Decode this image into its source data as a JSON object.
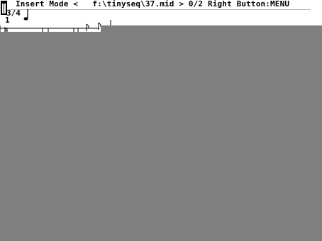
{
  "status_bar": {
    "mode_label": "Insert Mode",
    "file_prefix": "<",
    "file_path": "f:\\tinyseq\\37.mid",
    "file_suffix": ">",
    "page_indicator": "0/2",
    "hint": "Right Button:MENU"
  },
  "score": {
    "time_signature": "3/4",
    "measure_number": "1"
  },
  "icons": {
    "mode": "insert-cursor-icon",
    "note": "quarter-note-icon"
  },
  "colors": {
    "background": "#ffffff",
    "workspace": "#808080",
    "status_underline": "#8fd98f"
  }
}
